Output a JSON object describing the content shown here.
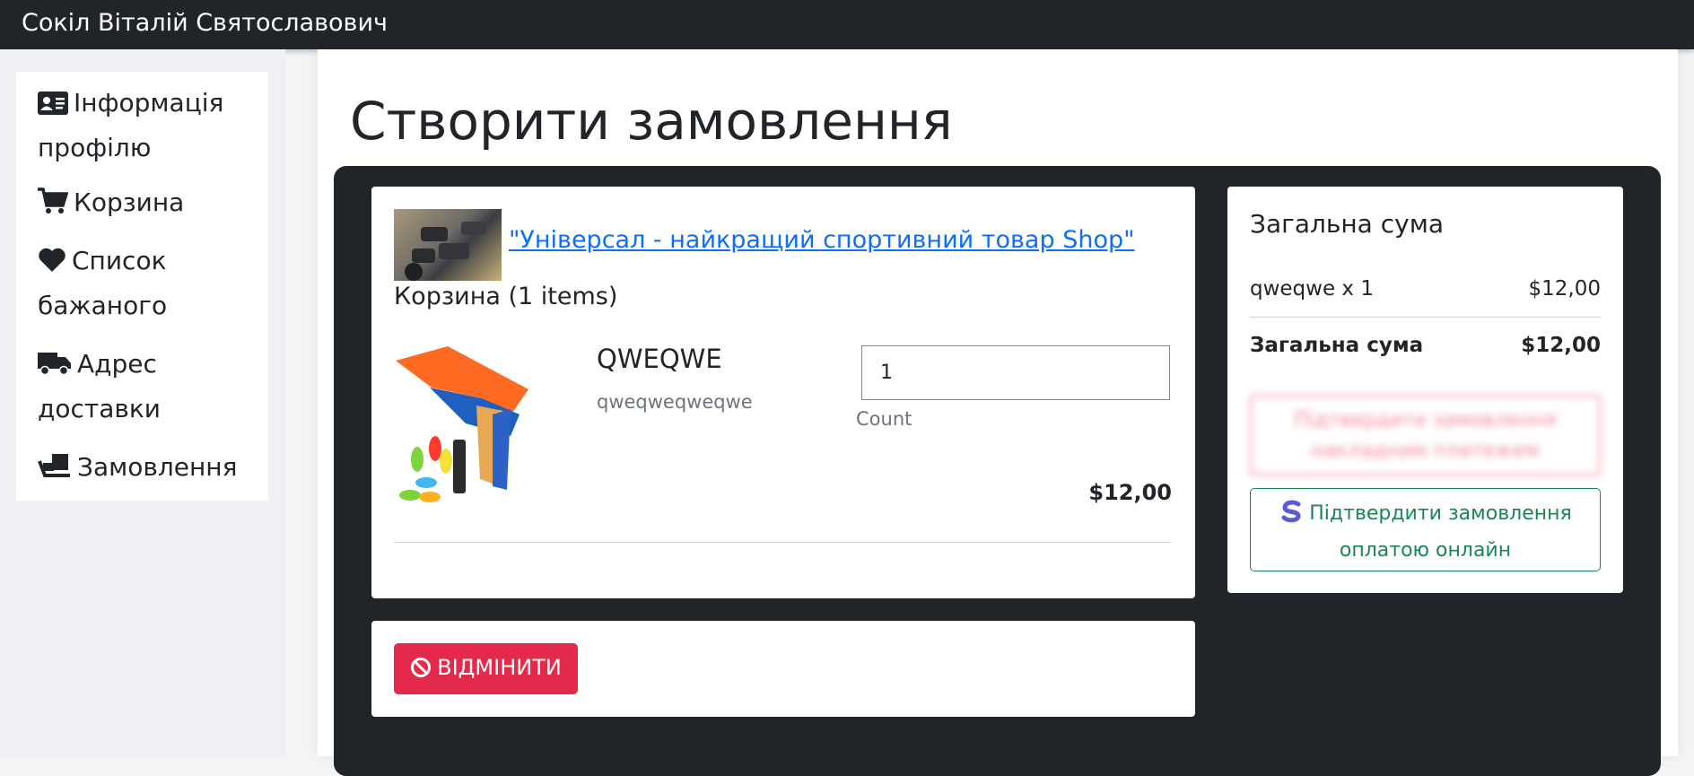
{
  "topbar": {
    "user_name": "Сокіл Віталій Святославович"
  },
  "sidebar": {
    "items": [
      {
        "label": "Інформація профілю",
        "icon": "id-card-icon"
      },
      {
        "label": "Корзина",
        "icon": "cart-icon"
      },
      {
        "label": "Список бажаного",
        "icon": "heart-icon"
      },
      {
        "label": "Адрес доставки",
        "icon": "truck-icon"
      },
      {
        "label": "Замовлення",
        "icon": "dolly-icon"
      }
    ]
  },
  "page": {
    "title": "Створити замовлення"
  },
  "cart": {
    "shop_link": "\"Універсал - найкращий спортивний товар Shop\"",
    "count_label": "Корзина (1 items)",
    "product": {
      "name": "QWEQWE",
      "description": "qweqweqweqwe",
      "quantity": "1",
      "quantity_label": "Count",
      "price": "$12,00"
    }
  },
  "cancel": {
    "label": "ВІДМІНИТИ",
    "icon": "ban-icon"
  },
  "summary": {
    "title": "Загальна сума",
    "line_item": "qweqwe x 1",
    "line_price": "$12,00",
    "total_label": "Загальна сума",
    "total_price": "$12,00",
    "cod_button": "Підтвердити замовлення накладним платежем",
    "online_button": "Підтвердити замовлення оплатою онлайн",
    "online_icon": "stripe-icon"
  },
  "colors": {
    "dark": "#212529",
    "danger": "#e4294b",
    "success": "#198754",
    "link": "#0d6efd"
  }
}
